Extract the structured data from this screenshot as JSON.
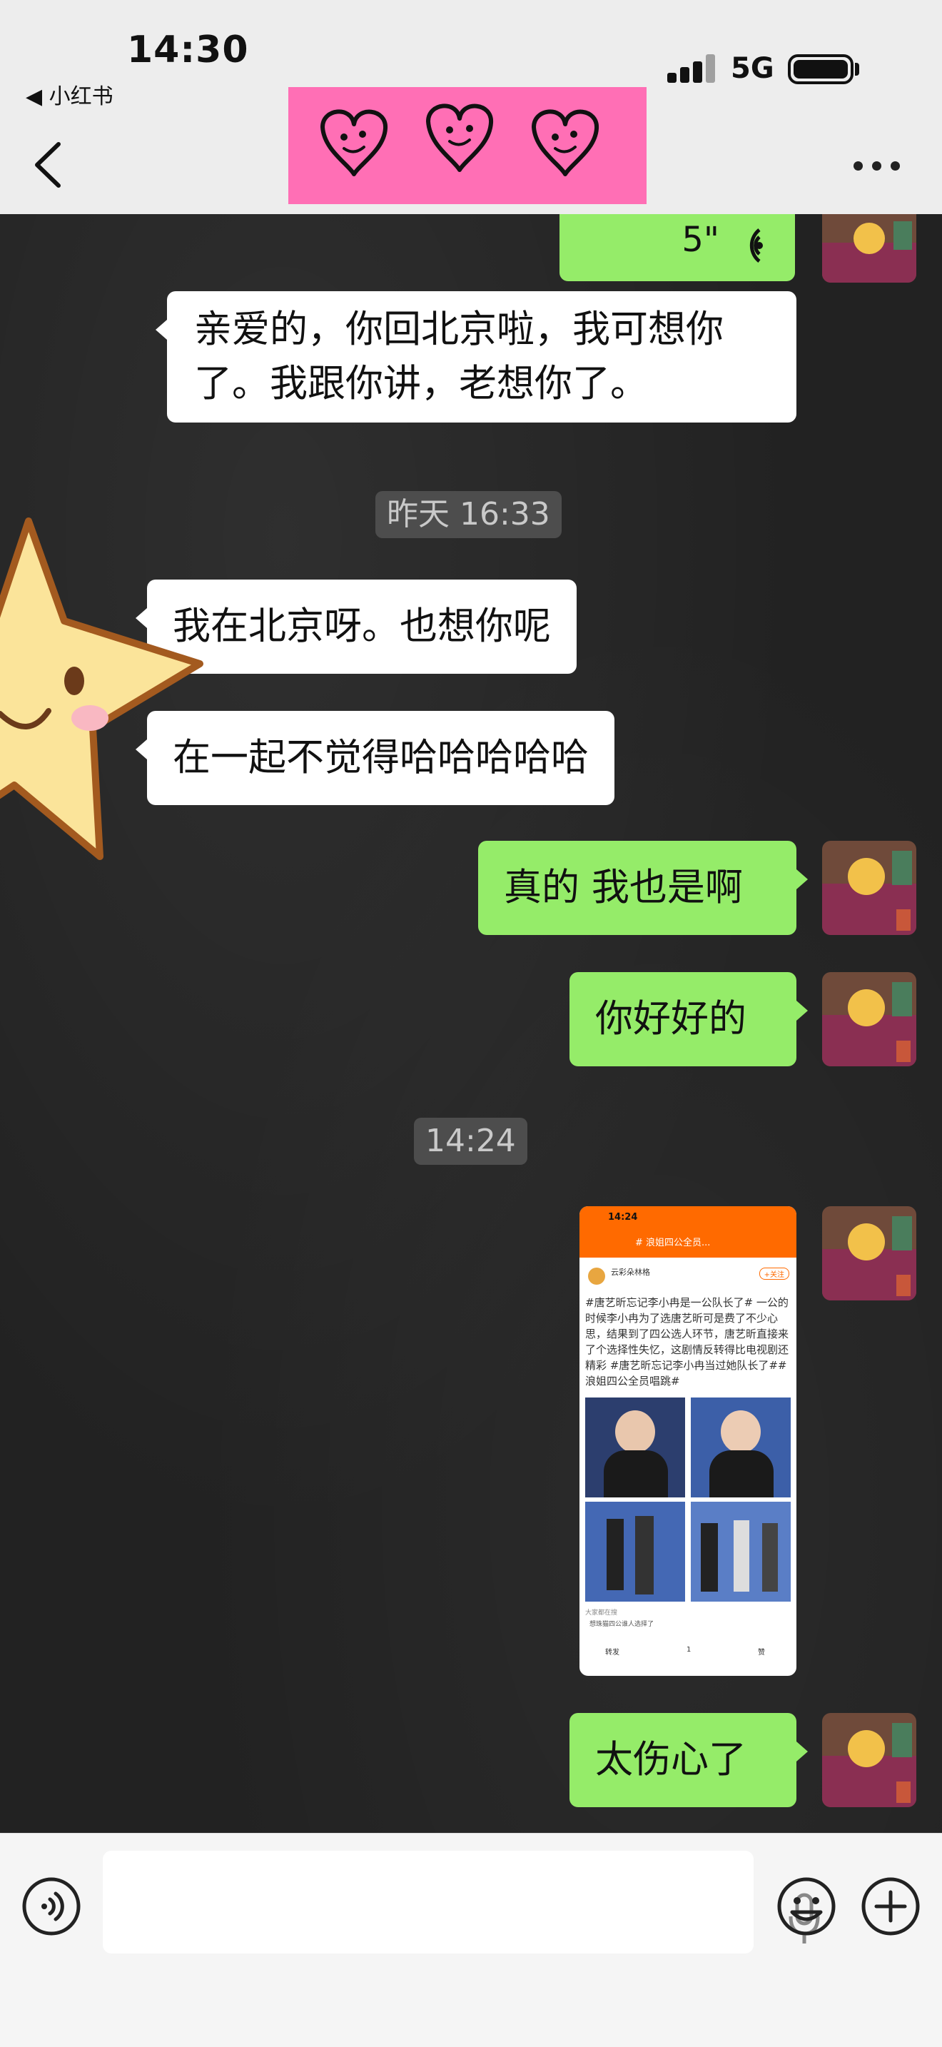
{
  "status_bar": {
    "time": "14:30",
    "back_app": "◀ 小红书",
    "network": "5G"
  },
  "header": {
    "back_icon": "chevron-left-icon",
    "sticker": "three-pink-hearts-sticker",
    "more_icon": "more-dots-icon"
  },
  "messages": {
    "voice": {
      "duration": "5\""
    },
    "m1": "亲爱的，你回北京啦，我可想你了。我跟你讲，老想你了。",
    "ts1": "昨天 16:33",
    "m2": "我在北京呀。也想你呢",
    "m3": "在一起不觉得哈哈哈哈哈",
    "m4": "真的 我也是啊",
    "m5": "你好好的",
    "ts2": "14:24",
    "m6": "太伤心了"
  },
  "shared_image": {
    "time": "14:24",
    "top_title": "# 浪姐四公全员...",
    "author": "云彩朵林格",
    "follow": "+关注",
    "post_text": "#唐艺昕忘记李小冉是一公队长了# 一公的时候李小冉为了选唐艺昕可是费了不少心思，结果到了四公选人环节，唐艺昕直接来了个选择性失忆，这剧情反转得比电视剧还精彩 #唐艺昕忘记李小冉当过她队长了##浪姐四公全员唱跳#",
    "footer_hint": "大家都在搜",
    "footer_link": "想珠猫四公谁人选择了",
    "repost": "转发",
    "comments": "1",
    "likes": "赞"
  },
  "colors": {
    "out_bubble": "#95ec69",
    "in_bubble": "#ffffff",
    "header_bg": "#ededed",
    "sticker_bg": "#ff6fb5",
    "image_header": "#ff6a00",
    "hashtag": "#3b6cc7"
  },
  "input": {
    "voice_icon": "voice-mode-icon",
    "mic_icon": "microphone-icon",
    "emoji_icon": "emoji-icon",
    "plus_icon": "plus-icon"
  }
}
